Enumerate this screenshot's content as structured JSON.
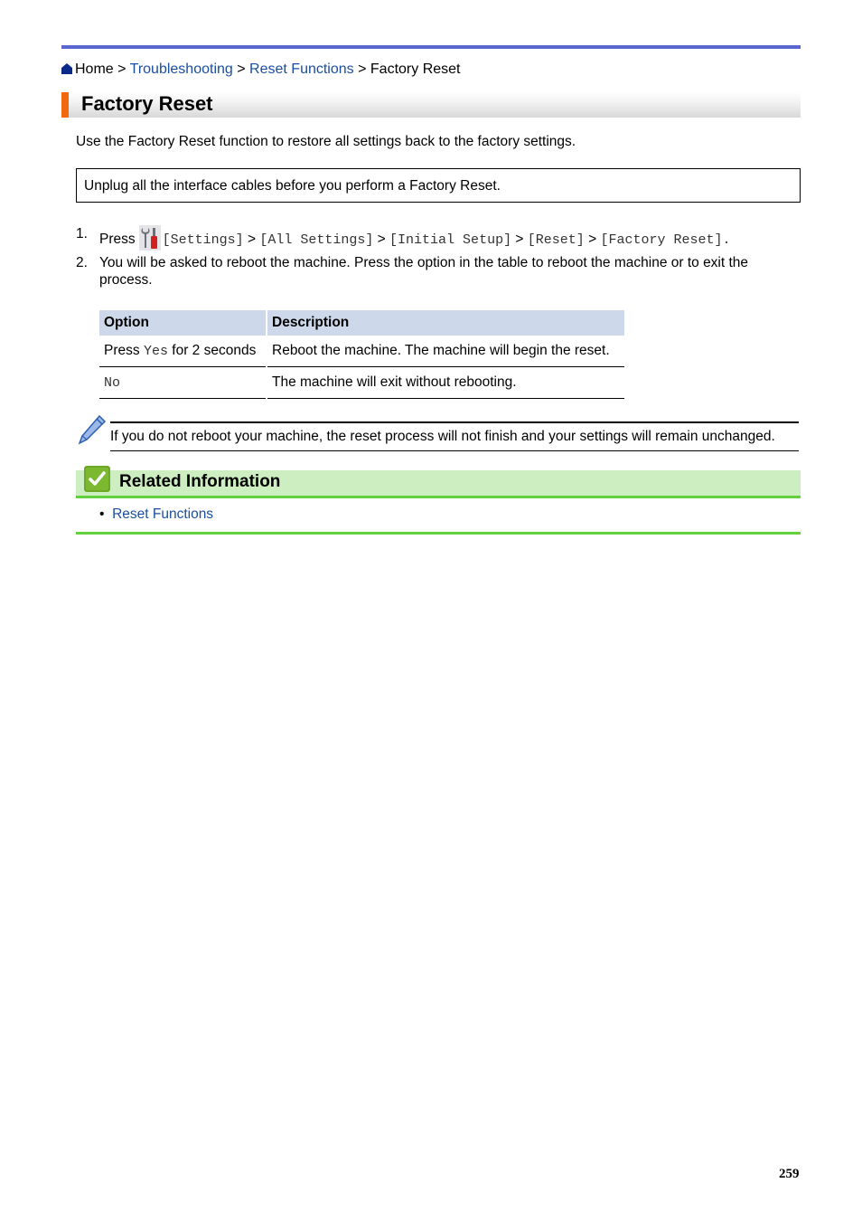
{
  "breadcrumb": {
    "home": "Home",
    "separator": ">",
    "items": [
      "Troubleshooting",
      "Reset Functions"
    ],
    "current": "Factory Reset"
  },
  "title": "Factory Reset",
  "intro": "Use the Factory Reset function to restore all settings back to the factory settings.",
  "important_note": "Unplug all the interface cables before you perform a Factory Reset.",
  "steps": [
    {
      "number": "1.",
      "press_label": "Press",
      "icon": "settings-tools-icon",
      "menu_path": [
        "[Settings]",
        "[All Settings]",
        "[Initial Setup]",
        "[Reset]",
        "[Factory Reset]"
      ],
      "separator": ">",
      "end": "."
    },
    {
      "number": "2.",
      "text": "You will be asked to reboot the machine. Press the option in the table to reboot the machine or to exit the process."
    }
  ],
  "options_table": {
    "headers": [
      "Option",
      "Description"
    ],
    "rows": [
      {
        "option_prefix": "Press",
        "option_code": "Yes",
        "option_suffix": "for 2 seconds",
        "description": "Reboot the machine. The machine will begin the reset."
      },
      {
        "option_prefix": "",
        "option_code": "No",
        "option_suffix": "",
        "description": "The machine will exit without rebooting."
      }
    ]
  },
  "note": {
    "icon": "pencil-note-icon",
    "text": "If you do not reboot your machine, the reset process will not finish and your settings will remain unchanged."
  },
  "related": {
    "icon": "checkmark-icon",
    "title": "Related Information",
    "links": [
      "Reset Functions"
    ]
  },
  "page_number": "259",
  "colors": {
    "top_rule": "#5b67d0",
    "title_accent": "#f26a10",
    "link": "#1a4fa0",
    "table_header": "#cdd8ea",
    "related_bg": "#cdeec0",
    "related_rule": "#63d13e"
  }
}
